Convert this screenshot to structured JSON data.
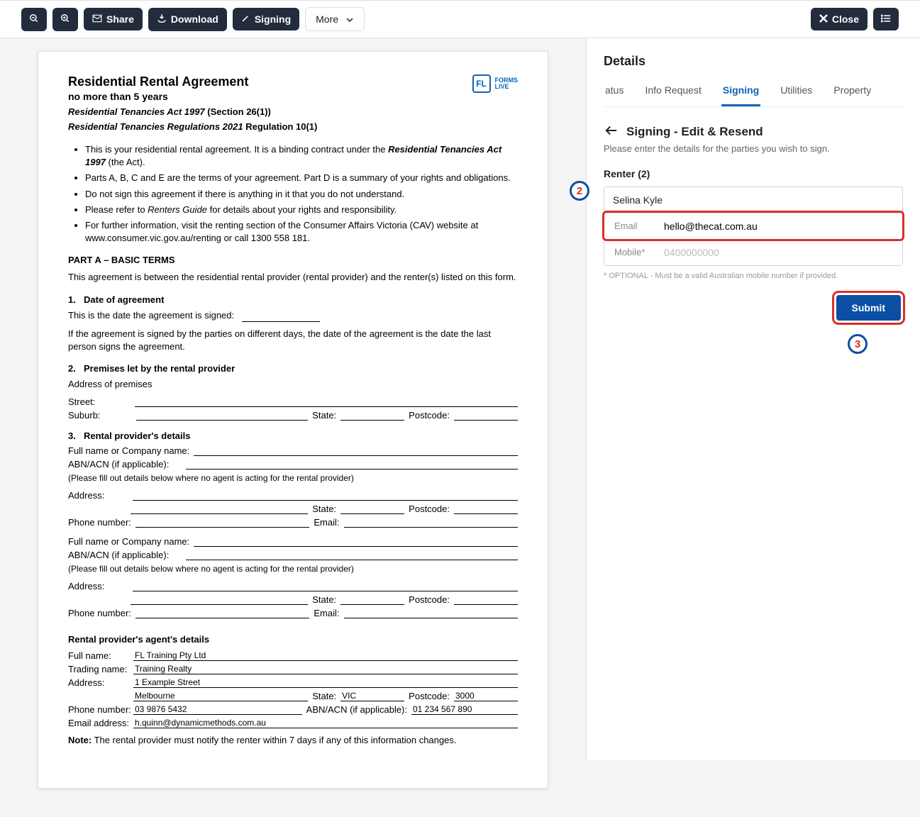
{
  "toolbar": {
    "share_label": "Share",
    "download_label": "Download",
    "signing_label": "Signing",
    "more_label": "More",
    "close_label": "Close"
  },
  "document": {
    "logo_text_top": "FORMS",
    "logo_text_bottom": "LIVE",
    "title": "Residential Rental Agreement",
    "subtitle": "no more than 5 years",
    "act_line_italic": "Residential Tenancies Act 1997",
    "act_line_rest": " (Section 26(1))",
    "reg_line_italic": "Residential Tenancies Regulations 2021",
    "reg_line_rest": " Regulation 10(1)",
    "bullets": {
      "b1_a": "This is your residential rental agreement. It is a binding contract under the ",
      "b1_bi": "Residential Tenancies Act 1997",
      "b1_c": " (the Act).",
      "b2": "Parts A, B, C and E are the terms of your agreement. Part D is a summary of your rights and obligations.",
      "b3": "Do not sign this agreement if there is anything in it that you do not understand.",
      "b4_a": "Please refer to ",
      "b4_i": "Renters Guide",
      "b4_b": " for details about your rights and responsibility.",
      "b5_a": "For further information, visit the renting section of the Consumer Affairs Victoria (CAV) website at",
      "b5_b": "www.consumer.vic.gov.au/renting or call 1300 558 181."
    },
    "part_a": "PART A – BASIC TERMS",
    "between": "This agreement is between the residential rental provider (rental provider) and the renter(s) listed on this form.",
    "s1": {
      "num": "1.",
      "title": "Date of agreement",
      "line1": "This is the date the agreement is signed:",
      "line2": "If the agreement is signed by the parties on different days, the date of the agreement is the date the last person signs the agreement."
    },
    "s2": {
      "num": "2.",
      "title": "Premises let by the rental provider",
      "addr": "Address of premises",
      "street": "Street:",
      "suburb": "Suburb:",
      "state": "State:",
      "postcode": "Postcode:"
    },
    "s3": {
      "num": "3.",
      "title": "Rental provider's details",
      "full_name": "Full name or Company name:",
      "abn": "ABN/ACN (if applicable):",
      "note": "(Please fill out details below where no agent is acting for the rental provider)",
      "address": "Address:",
      "phone": "Phone number:",
      "email": "Email:",
      "state": "State:",
      "postcode": "Postcode:"
    },
    "agent": {
      "title": "Rental provider's agent's details",
      "full_name_lbl": "Full name:",
      "full_name_val": "FL Training Pty Ltd",
      "trading_lbl": "Trading name:",
      "trading_val": "Training Realty",
      "address_lbl": "Address:",
      "address_val1": "1 Example Street",
      "address_val2": "Melbourne",
      "state_lbl": "State:",
      "state_val": "VIC",
      "postcode_lbl": "Postcode:",
      "postcode_val": "3000",
      "phone_lbl": "Phone number:",
      "phone_val": "03 9876 5432",
      "abn_lbl": "ABN/ACN (if applicable):",
      "abn_val": "01 234 567 890",
      "email_lbl": "Email address:",
      "email_val": "h.quinn@dynamicmethods.com.au",
      "notify_bold": "Note:",
      "notify_text": " The rental provider must notify the renter within 7 days if any of this information changes."
    }
  },
  "sidebar": {
    "title": "Details",
    "tabs": {
      "status": "atus",
      "info": "Info Request",
      "signing": "Signing",
      "utilities": "Utilities",
      "property": "Property"
    },
    "section_title": "Signing - Edit & Resend",
    "section_desc": "Please enter the details for the parties you wish to sign.",
    "party_label": "Renter (2)",
    "party_name": "Selina Kyle",
    "email_label": "Email",
    "email_value": "hello@thecat.com.au",
    "mobile_label": "Mobile*",
    "mobile_placeholder": "0400000000",
    "opt_note": "* OPTIONAL - Must be a valid Australian mobile number if provided.",
    "submit_label": "Submit",
    "callout2": "2",
    "callout3": "3"
  }
}
